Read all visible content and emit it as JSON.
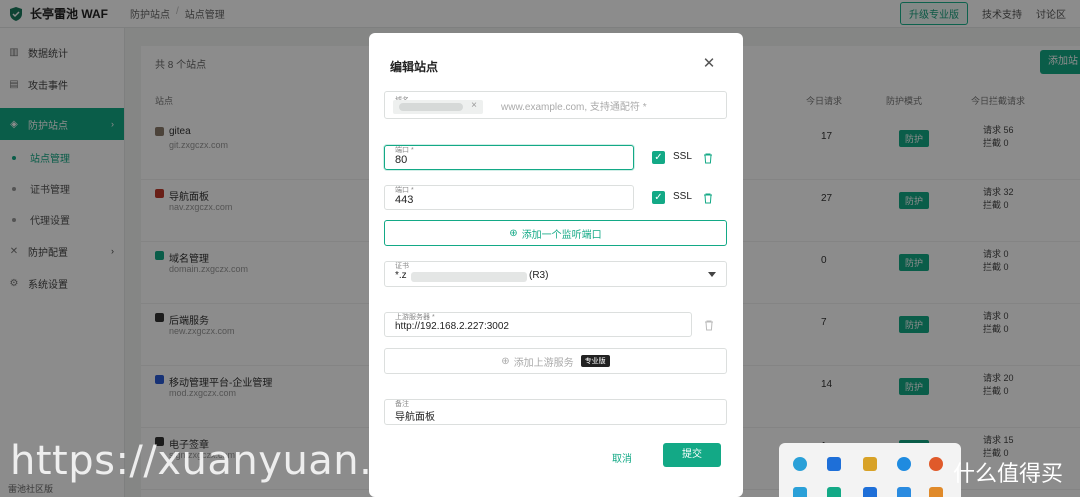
{
  "app": {
    "title": "长亭雷池 WAF",
    "breadcrumb": [
      "防护站点",
      "站点管理"
    ],
    "upgrade_label": "升级专业版",
    "top_links": [
      "技术支持",
      "讨论区"
    ]
  },
  "sidebar": {
    "items": [
      {
        "label": "数据统计",
        "icon": "chart-icon"
      },
      {
        "label": "攻击事件",
        "icon": "document-icon"
      },
      {
        "label": "防护站点",
        "icon": "shield-icon"
      }
    ],
    "sub_items": [
      "站点管理",
      "证书管理",
      "代理设置"
    ],
    "items2": [
      {
        "label": "防护配置",
        "icon": "tools-icon"
      },
      {
        "label": "系统设置",
        "icon": "gear-icon"
      }
    ],
    "footer": "雷池社区版"
  },
  "list": {
    "title": "共 8 个站点",
    "add_button": "添加站点",
    "headers": [
      "站点",
      "",
      "今日请求",
      "防护模式",
      "今日拦截请求"
    ],
    "rows": [
      {
        "name": "gitea",
        "domain": "git.zxgczx.com",
        "count": "17",
        "mode": "防护",
        "s1": "请求 56",
        "s2": "拦截 0",
        "color": "#8a7a6a"
      },
      {
        "name": "导航面板",
        "domain": "nav.zxgczx.com",
        "count": "27",
        "mode": "防护",
        "s1": "请求 32",
        "s2": "拦截 0",
        "color": "#c0392b"
      },
      {
        "name": "域名管理",
        "domain": "domain.zxgczx.com",
        "count": "0",
        "mode": "防护",
        "s1": "请求 0",
        "s2": "拦截 0",
        "color": "#13a986"
      },
      {
        "name": "后端服务",
        "domain": "new.zxgczx.com",
        "count": "7",
        "mode": "防护",
        "s1": "请求 0",
        "s2": "拦截 0",
        "color": "#333"
      },
      {
        "name": "移动管理平台-企业管理",
        "domain": "mod.zxgczx.com",
        "count": "14",
        "mode": "防护",
        "s1": "请求 20",
        "s2": "拦截 0",
        "color": "#2a5bd7"
      },
      {
        "name": "电子签章",
        "domain": "sign.zxgczx.com",
        "count": "1",
        "mode": "防护",
        "s1": "请求 15",
        "s2": "拦截 0",
        "color": "#333"
      }
    ]
  },
  "modal": {
    "title": "编辑站点",
    "domain_label": "域名",
    "domain_placeholder": "www.example.com, 支持通配符 *",
    "ports": [
      {
        "label": "端口 *",
        "value": "80",
        "ssl": "SSL"
      },
      {
        "label": "端口 *",
        "value": "443",
        "ssl": "SSL"
      }
    ],
    "add_port": "添加一个监听端口",
    "cert_label": "证书",
    "cert_prefix": "*.z",
    "cert_suffix": "(R3)",
    "upstream_label": "上游服务器 *",
    "upstream_value": "http://192.168.2.227:3002",
    "add_upstream": "添加上游服务",
    "pro_badge": "专业版",
    "remark_label": "备注",
    "remark_value": "导航面板",
    "cancel": "取消",
    "submit": "提交"
  },
  "watermark": "https://xuanyuan.me",
  "brand": "什么值得买"
}
